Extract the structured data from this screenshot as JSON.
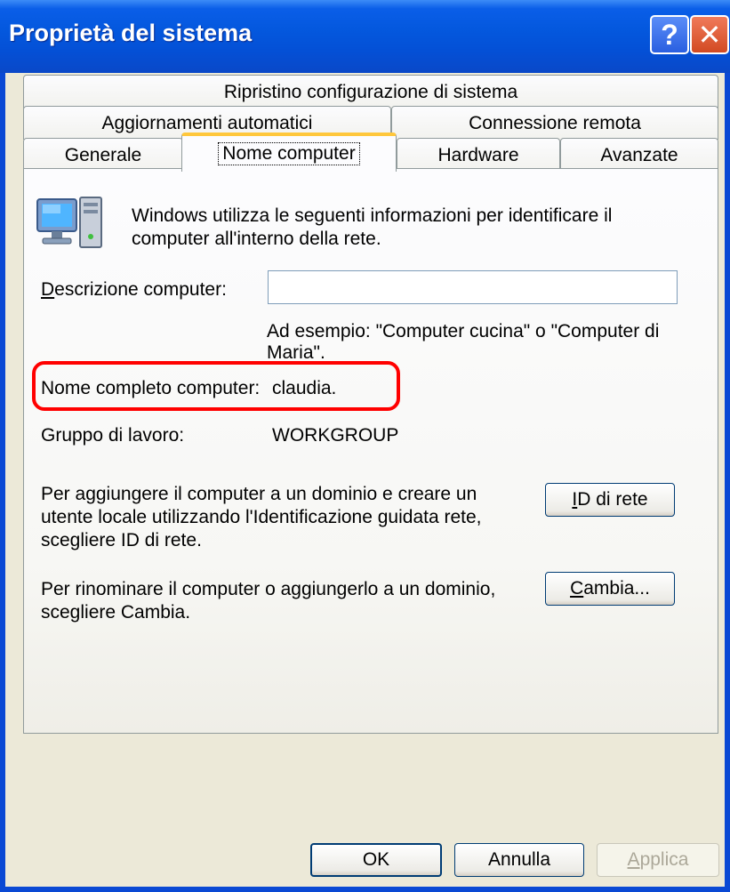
{
  "window": {
    "title": "Proprietà del sistema",
    "help_label": "?",
    "close_label": "✕"
  },
  "tabs": {
    "row1": [
      "Ripristino configurazione di sistema"
    ],
    "row2": [
      "Aggiornamenti automatici",
      "Connessione remota"
    ],
    "row3": [
      "Generale",
      "Nome computer",
      "Hardware",
      "Avanzate"
    ],
    "active": "Nome computer"
  },
  "content": {
    "icon": "computer-icon",
    "intro_line1": "Windows utilizza le seguenti informazioni per identificare il",
    "intro_line2": "computer all'interno della rete.",
    "description_label_accel": "D",
    "description_label_rest": "escrizione computer:",
    "description_value": "",
    "example_line1": "Ad esempio: \"Computer cucina\" o \"Computer di",
    "example_line2": "Maria\".",
    "full_name_label": "Nome completo computer:",
    "full_name_value": "claudia.",
    "workgroup_label": "Gruppo di lavoro:",
    "workgroup_value": "WORKGROUP",
    "network_id_line1": "Per aggiungere il computer a un dominio e creare un",
    "network_id_line2": "utente locale utilizzando l'Identificazione guidata rete,",
    "network_id_line3": "scegliere ID di rete.",
    "network_id_button_accel": "I",
    "network_id_button_rest": "D di rete",
    "rename_line1": "Per rinominare il computer o aggiungerlo a un dominio,",
    "rename_line2": "scegliere Cambia.",
    "change_button_accel": "C",
    "change_button_rest": "ambia..."
  },
  "footer": {
    "ok": "OK",
    "cancel": "Annulla",
    "apply_accel": "A",
    "apply_rest": "pplica"
  },
  "colors": {
    "titlebar": "#0458de",
    "highlight": "#ff0000",
    "active_tab_accent": "#ffc73c"
  }
}
